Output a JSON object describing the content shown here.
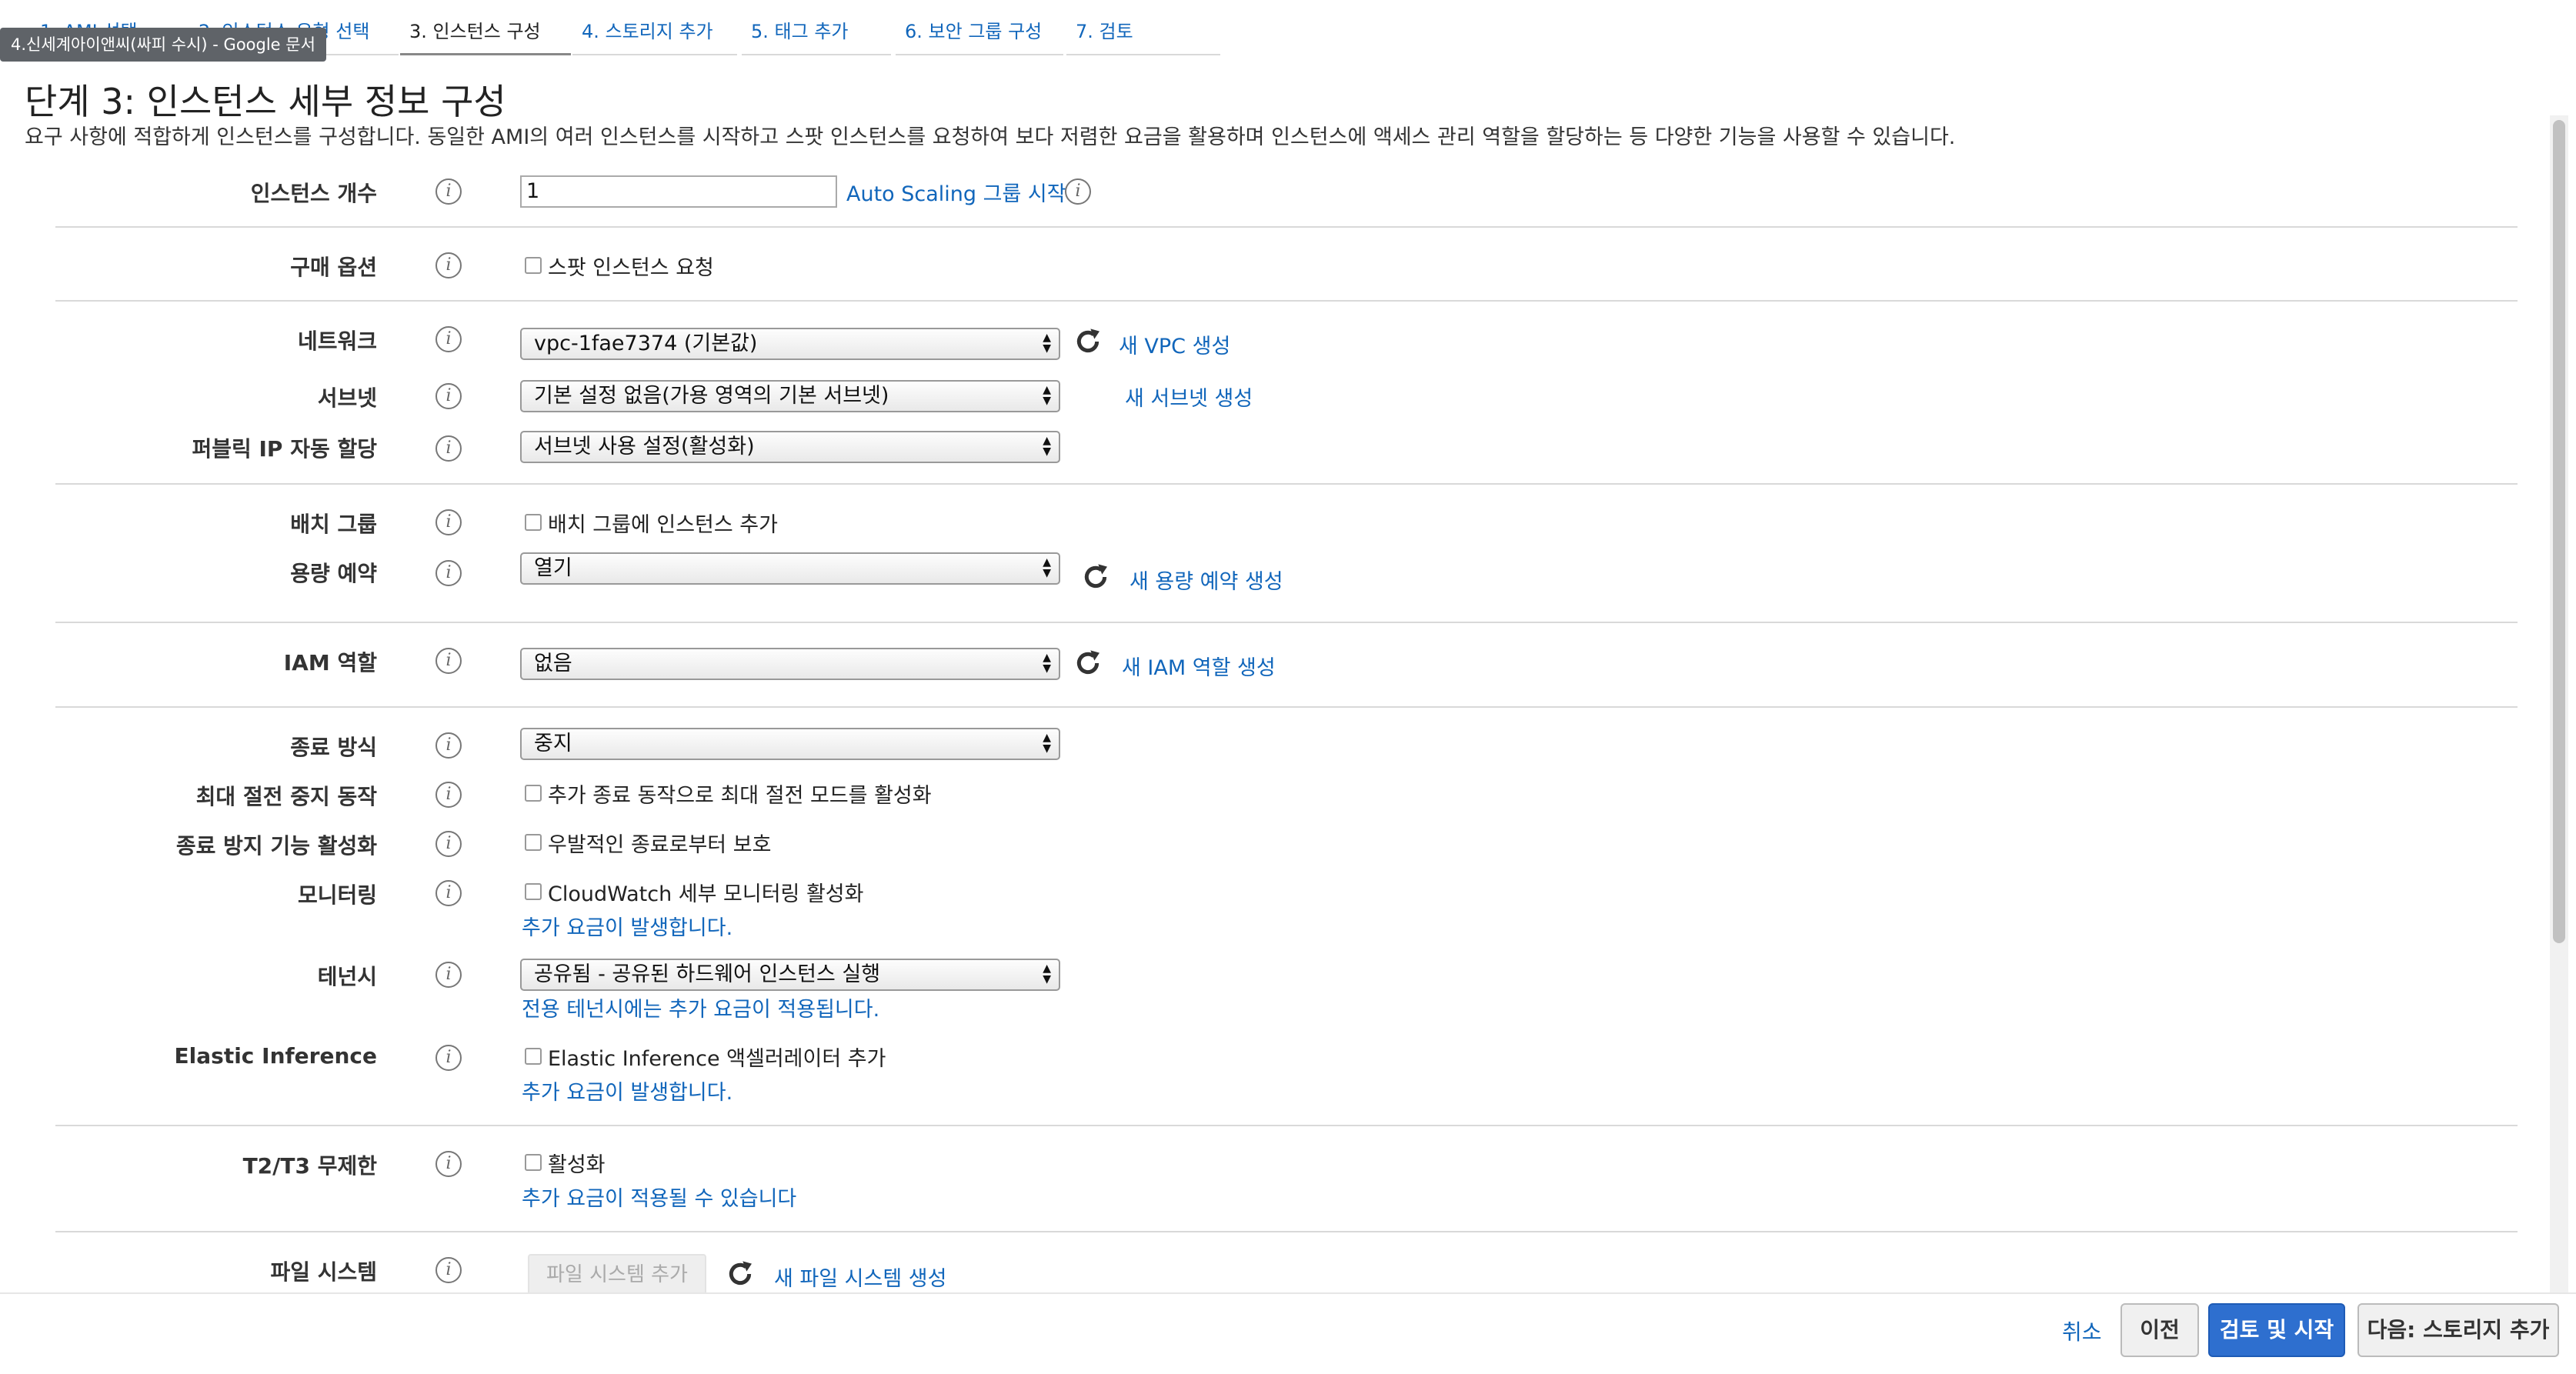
{
  "tooltip": "4.신세계아이앤씨(싸피 수시) - Google 문서",
  "tabs": [
    {
      "label": "1. AMI 선택"
    },
    {
      "label": "2. 인스턴스 유형 선택"
    },
    {
      "label": "3. 인스턴스 구성"
    },
    {
      "label": "4. 스토리지 추가"
    },
    {
      "label": "5. 태그 추가"
    },
    {
      "label": "6. 보안 그룹 구성"
    },
    {
      "label": "7. 검토"
    }
  ],
  "active_tab": "3. 인스턴스 구성",
  "page": {
    "title": "단계 3: 인스턴스 세부 정보 구성",
    "description": "요구 사항에 적합하게 인스턴스를 구성합니다. 동일한 AMI의 여러 인스턴스를 시작하고 스팟 인스턴스를 요청하여 보다 저렴한 요금을 활용하며 인스턴스에 액세스 관리 역할을 할당하는 등 다양한 기능을 사용할 수 있습니다."
  },
  "form": {
    "instance_count": {
      "label": "인스턴스 개수",
      "value": "1",
      "link": "Auto Scaling 그룹 시작"
    },
    "purchase_option": {
      "label": "구매 옵션",
      "checkbox": "스팟 인스턴스 요청"
    },
    "network": {
      "label": "네트워크",
      "value": "vpc-1fae7374 (기본값)",
      "link": "새 VPC 생성"
    },
    "subnet": {
      "label": "서브넷",
      "value": "기본 설정 없음(가용 영역의 기본 서브넷)",
      "link": "새 서브넷 생성"
    },
    "public_ip": {
      "label": "퍼블릭 IP 자동 할당",
      "value": "서브넷 사용 설정(활성화)"
    },
    "placement_group": {
      "label": "배치 그룹",
      "checkbox": "배치 그룹에 인스턴스 추가"
    },
    "capacity_reservation": {
      "label": "용량 예약",
      "value": "열기",
      "link": "새 용량 예약 생성"
    },
    "iam_role": {
      "label": "IAM 역할",
      "value": "없음",
      "link": "새 IAM 역할 생성"
    },
    "shutdown_behavior": {
      "label": "종료 방식",
      "value": "중지"
    },
    "stop_hibernate": {
      "label": "최대 절전 중지 동작",
      "checkbox": "추가 종료 동작으로 최대 절전 모드를 활성화"
    },
    "termination_protection": {
      "label": "종료 방지 기능 활성화",
      "checkbox": "우발적인 종료로부터 보호"
    },
    "monitoring": {
      "label": "모니터링",
      "checkbox": "CloudWatch 세부 모니터링 활성화",
      "note": "추가 요금이 발생합니다."
    },
    "tenancy": {
      "label": "테넌시",
      "value": "공유됨 - 공유된 하드웨어 인스턴스 실행",
      "note": "전용 테넌시에는 추가 요금이 적용됩니다."
    },
    "elastic_inference": {
      "label": "Elastic Inference",
      "checkbox": "Elastic Inference 액셀러레이터 추가",
      "note": "추가 요금이 발생합니다."
    },
    "t2t3_unlimited": {
      "label": "T2/T3 무제한",
      "checkbox": "활성화",
      "note": "추가 요금이 적용될 수 있습니다"
    },
    "file_systems": {
      "label": "파일 시스템",
      "button": "파일 시스템 추가",
      "link": "새 파일 시스템 생성"
    }
  },
  "footer": {
    "cancel": "취소",
    "previous": "이전",
    "review_launch": "검토 및 시작",
    "next": "다음: 스토리지 추가"
  },
  "colors": {
    "link": "#1166bb",
    "primary_button": "#2e6fcf"
  }
}
